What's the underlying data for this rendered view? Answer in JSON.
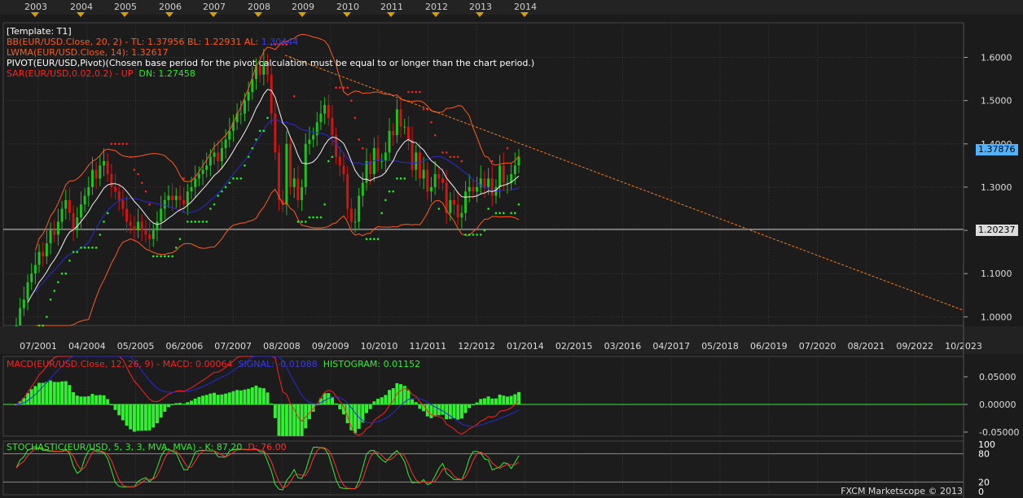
{
  "colors": {
    "background": "#1b1b1b",
    "panel": "#1c1c1c",
    "grid": "#3a3a3a",
    "up": "#1fc01f",
    "down": "#d01414",
    "bb": "#ff5a1e",
    "lwma": "#f2f2f2",
    "bb_mid": "#2a2ad8",
    "sar_up": "#ff2020",
    "sar_dn": "#22ee22",
    "histogram": "#33ee33",
    "macd_line": "#ff2020",
    "signal_line": "#2828e0",
    "stoch_k": "#33ee33",
    "stoch_d": "#ff3030",
    "trendline": "#ff7a1a",
    "current_price_bg": "#4fb3ff"
  },
  "top_years": [
    "2003",
    "2004",
    "2005",
    "2006",
    "2007",
    "2008",
    "2009",
    "2010",
    "2011",
    "2012",
    "2013",
    "2014"
  ],
  "legend": {
    "template": "[Template: T1]",
    "bb_prefix": "BB(EUR/USD.Close, 20, 2) -  TL: 1.37956  BL: 1.22931  AL: ",
    "bb_al": "1.30444",
    "lwma": "LWMA(EUR/USD.Close, 14): 1.32617",
    "pivot": "PIVOT(EUR/USD,Pivot)(Chosen base period for the pivot calculation must be equal to or longer than the chart period.)",
    "sar_up": "SAR(EUR/USD,0.02,0.2) -  UP",
    "sar_dn": "DN: 1.27458"
  },
  "macd_legend": {
    "macd": "MACD(EUR/USD.Close, 12, 26, 9) -  MACD: 0.00064",
    "signal": "SIGNAL: -0.01088",
    "histogram": "HISTOGRAM: 0.01152"
  },
  "stoch_legend": {
    "k": "STOCHASTIC(EUR/USD, 5, 3, 3, MVA, MVA) -  K: 87.20",
    "d": "D: 76.00"
  },
  "current_price": "1.37876",
  "horizontal_line_price": "1.20237",
  "copyright": "FXCM Marketscope © 2013",
  "chart_data": [
    {
      "type": "candlestick",
      "symbol": "EUR/USD",
      "x_labels": [
        "07/2001",
        "04/2004",
        "05/2005",
        "06/2006",
        "07/2007",
        "08/2008",
        "09/2009",
        "10/2010",
        "11/2011",
        "12/2012",
        "01/2014",
        "02/2015",
        "03/2016",
        "04/2017",
        "05/2018",
        "06/2019",
        "07/2020",
        "08/2021",
        "09/2022",
        "10/2023"
      ],
      "y_ticks": [
        1.0,
        1.1,
        1.2,
        1.3,
        1.4,
        1.5,
        1.6
      ],
      "ylim": [
        0.98,
        1.68
      ],
      "close": [
        0.98,
        1.02,
        1.04,
        1.08,
        1.1,
        1.12,
        1.15,
        1.14,
        1.17,
        1.2,
        1.19,
        1.22,
        1.25,
        1.27,
        1.24,
        1.2,
        1.23,
        1.26,
        1.28,
        1.3,
        1.34,
        1.32,
        1.35,
        1.36,
        1.33,
        1.3,
        1.29,
        1.27,
        1.25,
        1.22,
        1.21,
        1.2,
        1.22,
        1.2,
        1.19,
        1.18,
        1.2,
        1.22,
        1.25,
        1.27,
        1.28,
        1.27,
        1.28,
        1.27,
        1.26,
        1.29,
        1.3,
        1.32,
        1.33,
        1.34,
        1.35,
        1.37,
        1.38,
        1.36,
        1.39,
        1.41,
        1.43,
        1.45,
        1.47,
        1.47,
        1.5,
        1.52,
        1.55,
        1.58,
        1.56,
        1.59,
        1.56,
        1.47,
        1.38,
        1.27,
        1.26,
        1.4,
        1.3,
        1.32,
        1.27,
        1.3,
        1.4,
        1.41,
        1.42,
        1.45,
        1.47,
        1.49,
        1.46,
        1.42,
        1.37,
        1.35,
        1.33,
        1.25,
        1.22,
        1.22,
        1.28,
        1.31,
        1.36,
        1.33,
        1.39,
        1.36,
        1.36,
        1.38,
        1.43,
        1.42,
        1.48,
        1.44,
        1.44,
        1.41,
        1.34,
        1.38,
        1.32,
        1.34,
        1.29,
        1.3,
        1.33,
        1.32,
        1.31,
        1.24,
        1.27,
        1.26,
        1.23,
        1.24,
        1.29,
        1.3,
        1.29,
        1.3,
        1.32,
        1.3,
        1.32,
        1.28,
        1.3,
        1.35,
        1.31,
        1.31,
        1.33,
        1.35,
        1.37
      ]
    },
    {
      "type": "line",
      "name": "MACD",
      "y_ticks": [
        0.05,
        0.0,
        -0.05
      ]
    },
    {
      "type": "line",
      "name": "STOCHASTIC",
      "y_ticks": [
        100,
        80,
        20,
        0
      ]
    }
  ]
}
